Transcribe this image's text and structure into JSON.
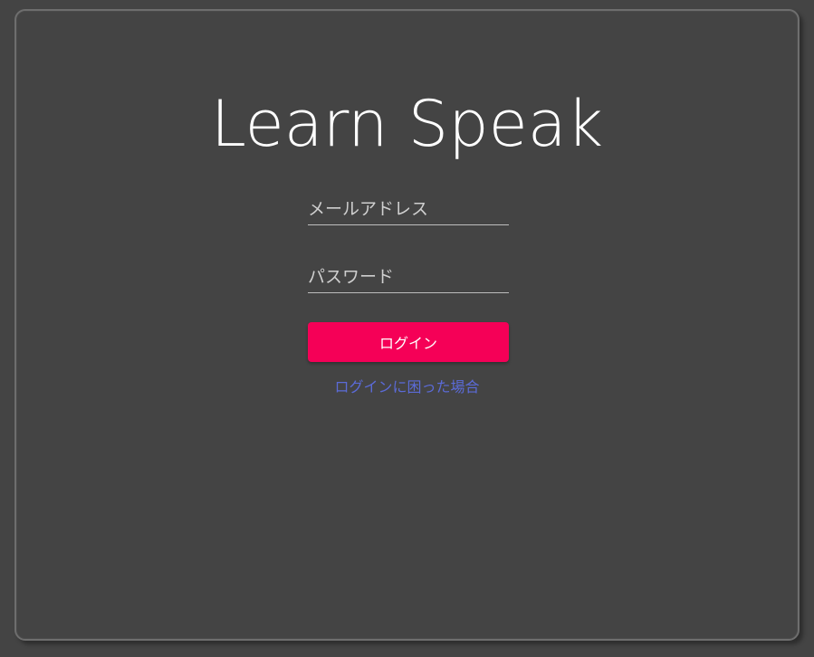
{
  "app": {
    "title": "Learn Speak"
  },
  "login_form": {
    "email": {
      "placeholder": "メールアドレス",
      "value": ""
    },
    "password": {
      "placeholder": "パスワード",
      "value": ""
    },
    "submit_label": "ログイン",
    "help_link_label": "ログインに困った場合"
  },
  "colors": {
    "background": "#444444",
    "panel_border": "#6e6e6e",
    "button": "#f50057",
    "link": "#5b6bd8",
    "title_text": "#ffffff"
  }
}
